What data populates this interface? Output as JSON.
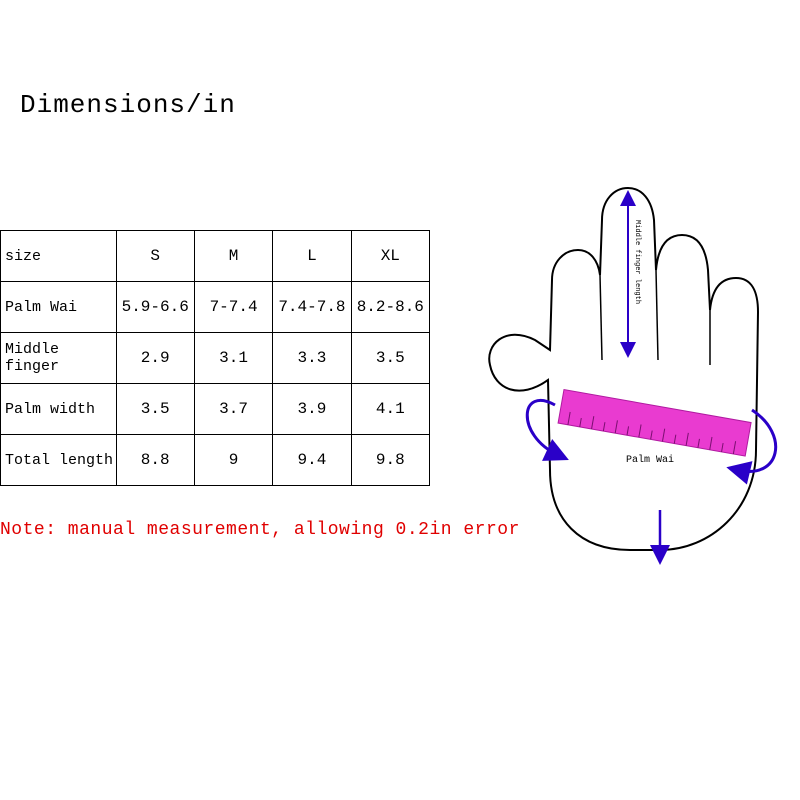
{
  "title": "Dimensions/in",
  "table": {
    "header_label": "size",
    "sizes": [
      "S",
      "M",
      "L",
      "XL"
    ],
    "rows": [
      {
        "label": "Palm Wai",
        "values": [
          "5.9-6.6",
          "7-7.4",
          "7.4-7.8",
          "8.2-8.6"
        ]
      },
      {
        "label": "Middle finger",
        "values": [
          "2.9",
          "3.1",
          "3.3",
          "3.5"
        ]
      },
      {
        "label": "Palm width",
        "values": [
          "3.5",
          "3.7",
          "3.9",
          "4.1"
        ]
      },
      {
        "label": "Total length",
        "values": [
          "8.8",
          "9",
          "9.4",
          "9.8"
        ]
      }
    ]
  },
  "note": "Note: manual measurement, allowing 0.2in error",
  "diagram": {
    "middle_finger_label": "Middle finger length",
    "palm_wai_label": "Palm Wai"
  },
  "chart_data": {
    "type": "table",
    "title": "Dimensions/in",
    "columns": [
      "size",
      "S",
      "M",
      "L",
      "XL"
    ],
    "rows": [
      [
        "Palm Wai",
        "5.9-6.6",
        "7-7.4",
        "7.4-7.8",
        "8.2-8.6"
      ],
      [
        "Middle finger",
        2.9,
        3.1,
        3.3,
        3.5
      ],
      [
        "Palm width",
        3.5,
        3.7,
        3.9,
        4.1
      ],
      [
        "Total length",
        8.8,
        9,
        9.4,
        9.8
      ]
    ]
  }
}
